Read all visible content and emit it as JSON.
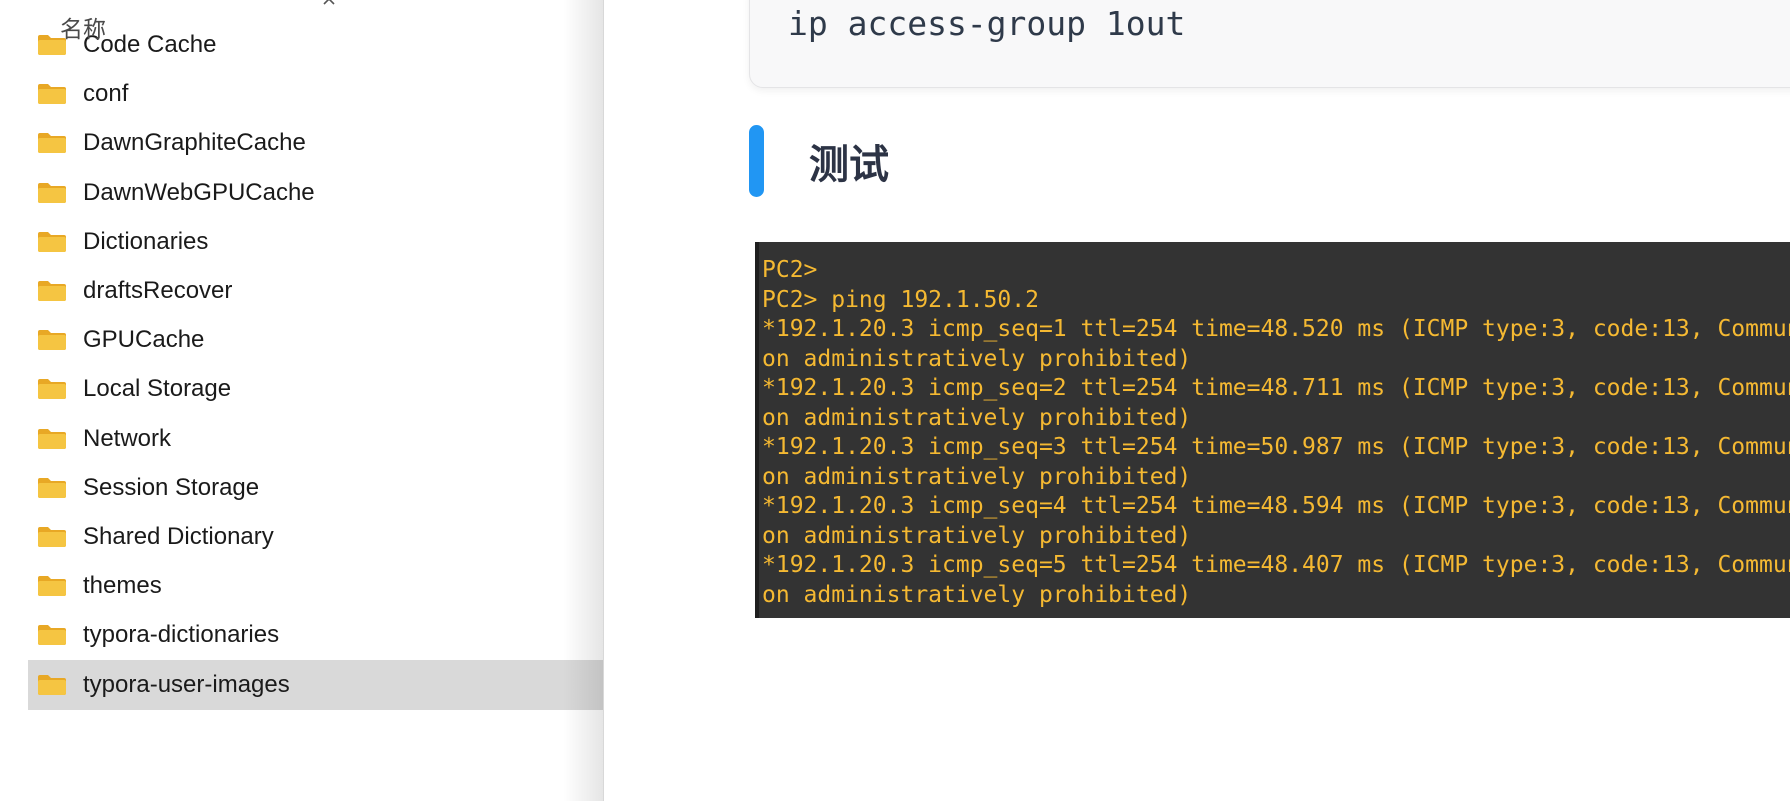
{
  "explorer": {
    "column_header": "名称",
    "files": [
      {
        "name": "Code Cache",
        "selected": false
      },
      {
        "name": "conf",
        "selected": false
      },
      {
        "name": "DawnGraphiteCache",
        "selected": false
      },
      {
        "name": "DawnWebGPUCache",
        "selected": false
      },
      {
        "name": "Dictionaries",
        "selected": false
      },
      {
        "name": "draftsRecover",
        "selected": false
      },
      {
        "name": "GPUCache",
        "selected": false
      },
      {
        "name": "Local Storage",
        "selected": false
      },
      {
        "name": "Network",
        "selected": false
      },
      {
        "name": "Session Storage",
        "selected": false
      },
      {
        "name": "Shared Dictionary",
        "selected": false
      },
      {
        "name": "themes",
        "selected": false
      },
      {
        "name": "typora-dictionaries",
        "selected": false
      },
      {
        "name": "typora-user-images",
        "selected": true
      }
    ],
    "colors": {
      "folder": "#f5c542",
      "selected_row": "#d9d9d9"
    }
  },
  "document": {
    "code_block": {
      "text": "ip access-group 1out"
    },
    "heading": {
      "text": "测试",
      "accent_color": "#2196f3"
    },
    "terminal": {
      "lines": [
        "PC2>",
        "PC2> ping 192.1.50.2",
        "*192.1.20.3 icmp_seq=1 ttl=254 time=48.520 ms (ICMP type:3, code:13, Commun",
        "on administratively prohibited)",
        "*192.1.20.3 icmp_seq=2 ttl=254 time=48.711 ms (ICMP type:3, code:13, Commun",
        "on administratively prohibited)",
        "*192.1.20.3 icmp_seq=3 ttl=254 time=50.987 ms (ICMP type:3, code:13, Commun",
        "on administratively prohibited)",
        "*192.1.20.3 icmp_seq=4 ttl=254 time=48.594 ms (ICMP type:3, code:13, Commun",
        "on administratively prohibited)",
        "*192.1.20.3 icmp_seq=5 ttl=254 time=48.407 ms (ICMP type:3, code:13, Commun",
        "on administratively prohibited)"
      ],
      "text_color": "#f5b932",
      "background": "#333333"
    }
  }
}
